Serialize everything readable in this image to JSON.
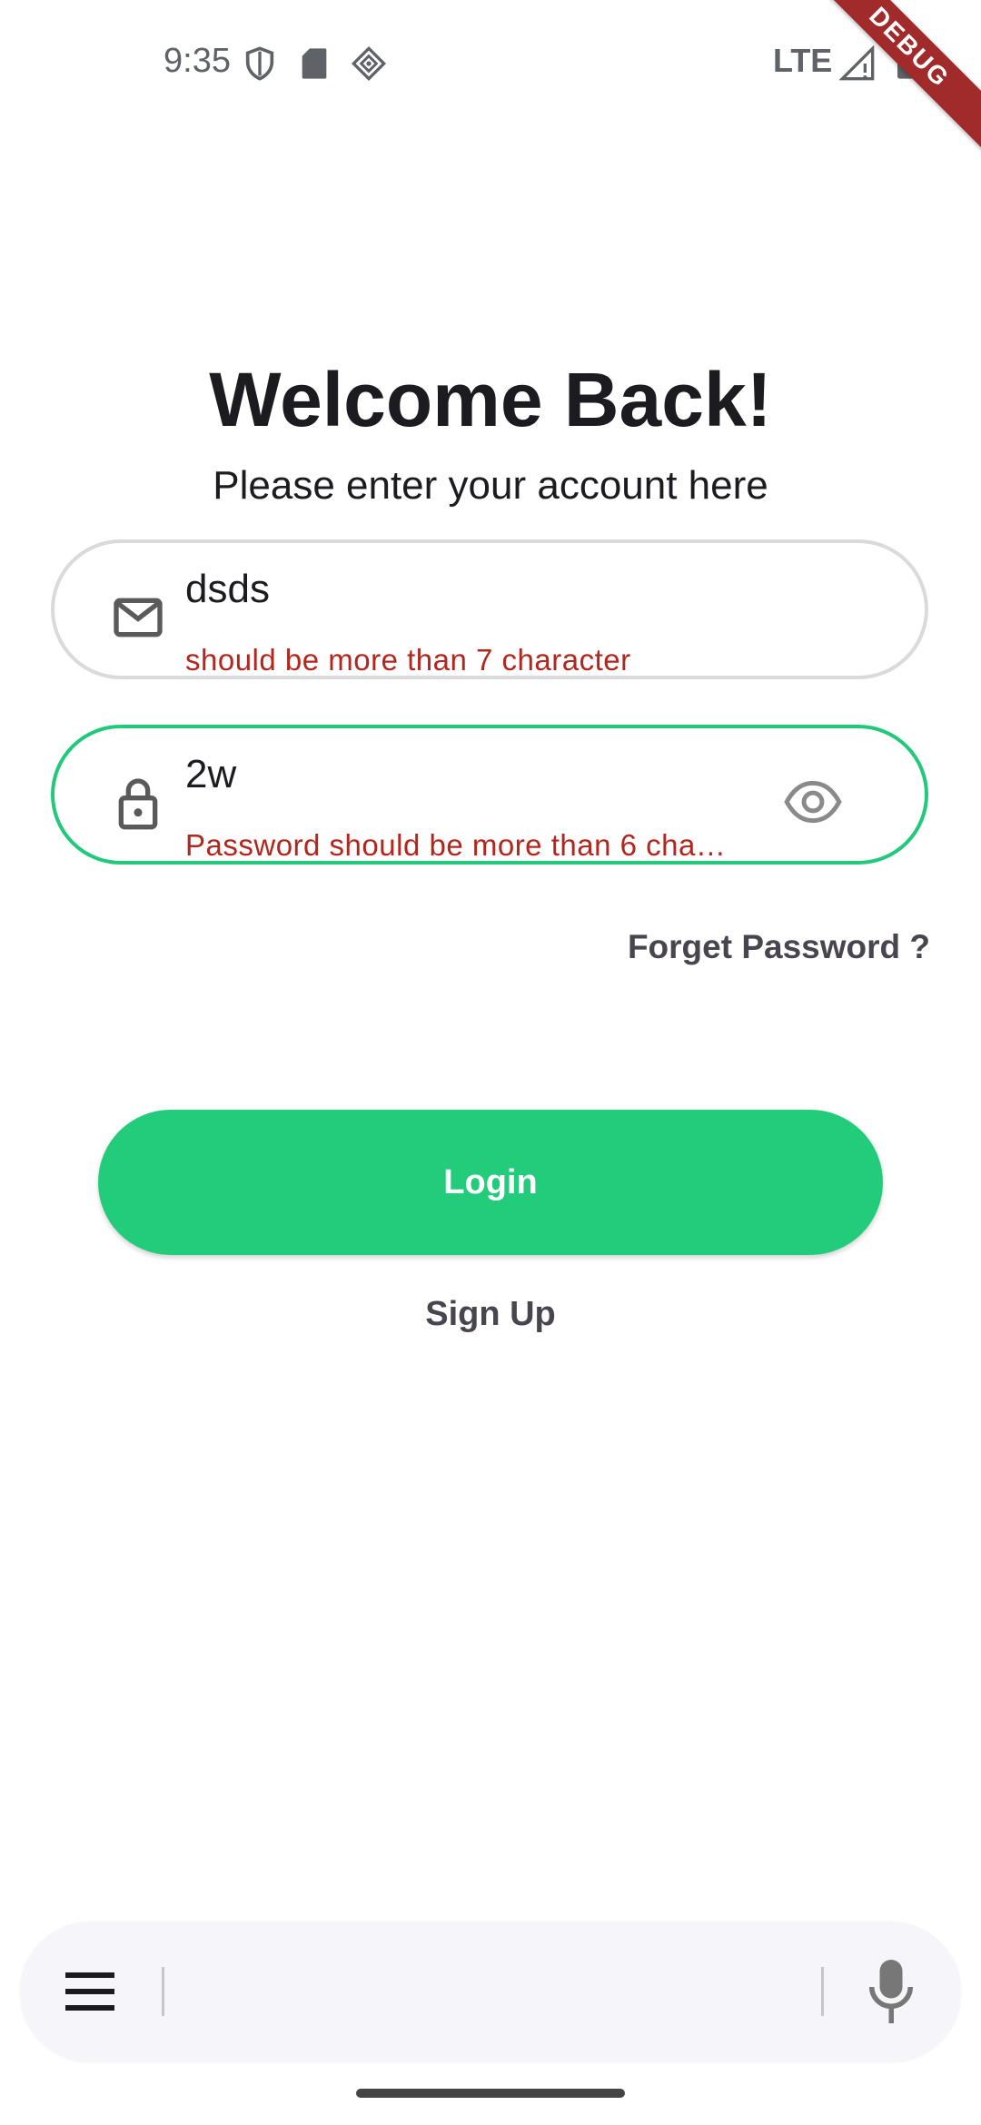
{
  "status_bar": {
    "time": "9:35",
    "network": "LTE",
    "icons": [
      "shield-icon",
      "sd-card-icon",
      "vpn-diamond-icon",
      "signal-icon",
      "battery-icon"
    ]
  },
  "debug_banner": "DEBUG",
  "header": {
    "title": "Welcome Back!",
    "subtitle": "Please enter your account here"
  },
  "form": {
    "email": {
      "icon": "mail-icon",
      "value": "dsds",
      "error": "should be more than 7 character"
    },
    "password": {
      "icon": "lock-icon",
      "value": "2w",
      "error": "Password should be more than 6 cha…",
      "toggle_icon": "eye-icon"
    },
    "forget_label": "Forget Password ?"
  },
  "actions": {
    "login_label": "Login",
    "signup_label": "Sign Up"
  },
  "colors": {
    "accent": "#22cc7b",
    "error": "#b3261e",
    "focused_border": "#22c97a"
  },
  "bottom_bar": {
    "icons": [
      "menu-icon",
      "mic-icon"
    ]
  }
}
